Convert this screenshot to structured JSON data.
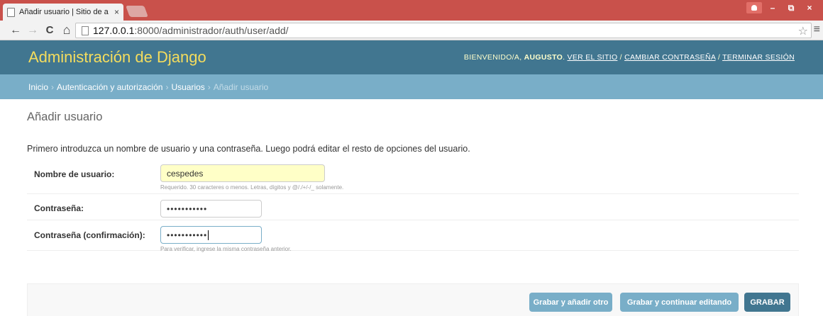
{
  "browser": {
    "tab_title": "Añadir usuario | Sitio de a",
    "tab_close": "×",
    "window_controls": {
      "minimize": "–",
      "maximize": "⧉",
      "close": "×"
    },
    "nav": {
      "back": "←",
      "forward": "→",
      "reload": "C",
      "home": "⌂"
    },
    "url_host": "127.0.0.1",
    "url_path": ":8000/administrador/auth/user/add/",
    "star": "☆",
    "menu": "≡"
  },
  "header": {
    "branding": "Administración de Django",
    "welcome": "BIENVENIDO/A,",
    "username": "AUGUSTO",
    "view_site": "VER EL SITIO",
    "change_password": "CAMBIAR CONTRASEÑA",
    "logout": "TERMINAR SESIÓN",
    "separator": "/"
  },
  "breadcrumbs": {
    "items": [
      "Inicio",
      "Autenticación y autorización",
      "Usuarios"
    ],
    "current": "Añadir usuario",
    "separator": "›"
  },
  "page": {
    "title": "Añadir usuario",
    "intro": "Primero introduzca un nombre de usuario y una contraseña. Luego podrá editar el resto de opciones del usuario."
  },
  "form": {
    "username": {
      "label": "Nombre de usuario:",
      "value": "cespedes",
      "help": "Requerido. 30 caracteres o menos. Letras, dígitos y @/./+/-/_ solamente."
    },
    "password1": {
      "label": "Contraseña:",
      "value": "•••••••••••"
    },
    "password2": {
      "label": "Contraseña (confirmación):",
      "value": "•••••••••••",
      "help": "Para verificar, ingrese la misma contraseña anterior."
    }
  },
  "actions": {
    "save_add_another": "Grabar y añadir otro",
    "save_continue": "Grabar y continuar editando",
    "save": "GRABAR"
  },
  "colors": {
    "header_bg": "#417690",
    "breadcrumb_bg": "#79aec8",
    "branding": "#f5dd5d",
    "titlebar": "#c9514b"
  }
}
